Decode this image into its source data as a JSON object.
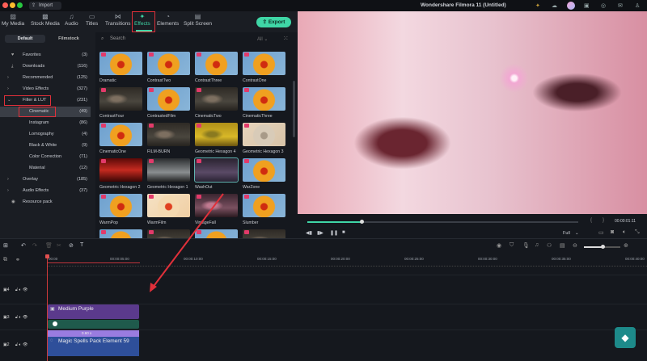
{
  "app": {
    "title": "Wondershare Filmora 11 (Untitled)",
    "import_label": "Import",
    "export_label": "Export"
  },
  "nav": [
    {
      "label": "My Media",
      "icon": "image-icon"
    },
    {
      "label": "Stock Media",
      "icon": "stock-icon"
    },
    {
      "label": "Audio",
      "icon": "music-icon"
    },
    {
      "label": "Titles",
      "icon": "titles-icon"
    },
    {
      "label": "Transitions",
      "icon": "transition-icon"
    },
    {
      "label": "Effects",
      "icon": "sparkle-icon",
      "active": true
    },
    {
      "label": "Elements",
      "icon": "elements-icon"
    },
    {
      "label": "Split Screen",
      "icon": "split-screen-icon"
    }
  ],
  "library_tabs": [
    "Default",
    "Filmstock"
  ],
  "categories": [
    {
      "label": "Favorites",
      "count": "(3)",
      "icon": "heart-icon"
    },
    {
      "label": "Downloads",
      "count": "(116)",
      "icon": "download-icon"
    },
    {
      "label": "Recommended",
      "count": "(125)",
      "arrow": "›"
    },
    {
      "label": "Video Effects",
      "count": "(327)",
      "arrow": "›"
    },
    {
      "label": "Filter & LUT",
      "count": "(231)",
      "arrow": "⌄",
      "highlight": true
    },
    {
      "label": "Cinematic",
      "count": "(49)",
      "sub": true,
      "selected": true
    },
    {
      "label": "Instagram",
      "count": "(86)",
      "sub": true
    },
    {
      "label": "Lomography",
      "count": "(4)",
      "sub": true
    },
    {
      "label": "Black & White",
      "count": "(9)",
      "sub": true
    },
    {
      "label": "Color Correction",
      "count": "(71)",
      "sub": true
    },
    {
      "label": "Material",
      "count": "(12)",
      "sub": true
    },
    {
      "label": "Overlay",
      "count": "(185)",
      "arrow": "›"
    },
    {
      "label": "Audio Effects",
      "count": "(37)",
      "arrow": "›"
    },
    {
      "label": "Resource pack",
      "count": "",
      "icon": "resource-icon"
    }
  ],
  "search": {
    "placeholder": "Search",
    "filter": "All"
  },
  "effects": [
    {
      "name": "Dramatic",
      "style": "flower"
    },
    {
      "name": "ContrastTwo",
      "style": "flower"
    },
    {
      "name": "ContrastThree",
      "style": "flower"
    },
    {
      "name": "ContrastOne",
      "style": "flower"
    },
    {
      "name": "ContrastFour",
      "style": "dark"
    },
    {
      "name": "ContrastedFilm",
      "style": "flower"
    },
    {
      "name": "CinematicTwo",
      "style": "dark"
    },
    {
      "name": "CinematicThree",
      "style": "flower"
    },
    {
      "name": "CinematicOne",
      "style": "flower"
    },
    {
      "name": "FILM-BURN",
      "style": "dark"
    },
    {
      "name": "Geometric Hexagon 4",
      "style": "yellow"
    },
    {
      "name": "Geometric Hexagon 3",
      "style": "sepia"
    },
    {
      "name": "Geometric Hexagon 2",
      "style": "red"
    },
    {
      "name": "Geometric Hexagon 1",
      "style": "gray"
    },
    {
      "name": "WashOut",
      "style": "purple",
      "selected": true
    },
    {
      "name": "WarZone",
      "style": "flower"
    },
    {
      "name": "WarmPop",
      "style": "flower"
    },
    {
      "name": "WarmFilm",
      "style": "warm"
    },
    {
      "name": "VintageFall",
      "style": "pinkdark"
    },
    {
      "name": "Slumber",
      "style": "flower"
    }
  ],
  "player": {
    "timecode": "00:00:01:11",
    "quality": "Full",
    "progress": 0.2
  },
  "ruler": [
    "00:00",
    "00:00:05:00",
    "00:00:10:00",
    "00:00:15:00",
    "00:00:20:00",
    "00:00:25:00",
    "00:00:30:00",
    "00:00:35:00",
    "00:00:40:00"
  ],
  "tracks": [
    {
      "num": "4"
    },
    {
      "num": "3"
    },
    {
      "num": "2"
    }
  ],
  "clips": {
    "purple": "Medium Purple",
    "magic": "Magic Spells Pack Element 59",
    "speed": "0.60 x"
  },
  "colors": {
    "accent": "#3fd6a6",
    "highlight": "#e0303a",
    "purple_clip": "#5b3a8c",
    "blue_clip": "#2e4f9a"
  }
}
